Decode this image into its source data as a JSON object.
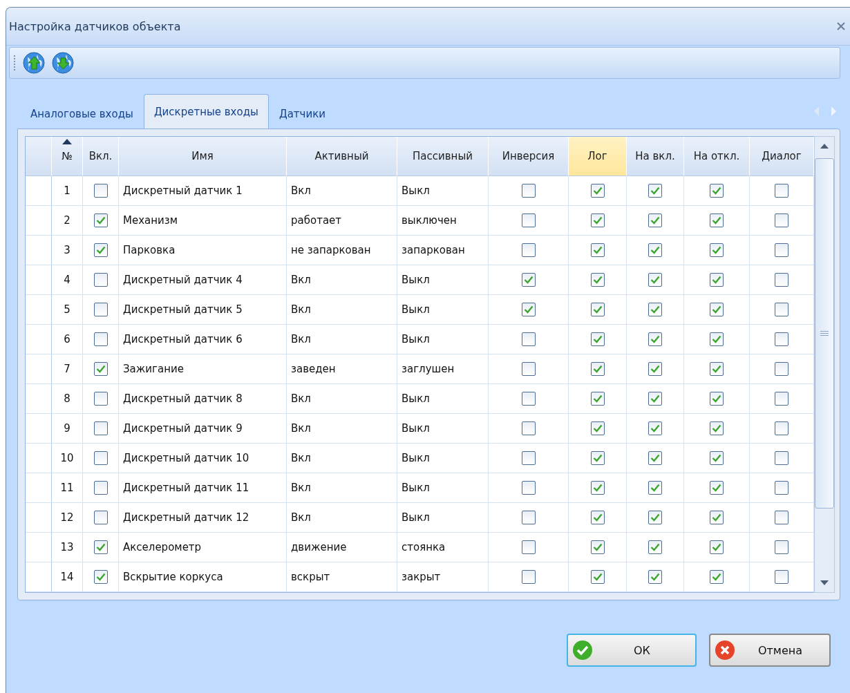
{
  "window": {
    "title": "Настройка датчиков объекта"
  },
  "tabs": [
    {
      "label": "Аналоговые входы",
      "selected": false
    },
    {
      "label": "Дискретные входы",
      "selected": true
    },
    {
      "label": "Датчики",
      "selected": false
    }
  ],
  "table": {
    "columns": [
      {
        "label": "№",
        "kind": "number",
        "sorted": true,
        "highlighted": false
      },
      {
        "label": "Вкл.",
        "kind": "check",
        "sorted": false,
        "highlighted": false
      },
      {
        "label": "Имя",
        "kind": "text",
        "sorted": false,
        "highlighted": false
      },
      {
        "label": "Активный",
        "kind": "text",
        "sorted": false,
        "highlighted": false
      },
      {
        "label": "Пассивный",
        "kind": "text",
        "sorted": false,
        "highlighted": false
      },
      {
        "label": "Инверсия",
        "kind": "check",
        "sorted": false,
        "highlighted": false
      },
      {
        "label": "Лог",
        "kind": "check",
        "sorted": false,
        "highlighted": true
      },
      {
        "label": "На вкл.",
        "kind": "check",
        "sorted": false,
        "highlighted": false
      },
      {
        "label": "На откл.",
        "kind": "check",
        "sorted": false,
        "highlighted": false
      },
      {
        "label": "Диалог",
        "kind": "check",
        "sorted": false,
        "highlighted": false
      }
    ],
    "rows": [
      {
        "cells": [
          "1",
          false,
          "Дискретный датчик 1",
          "Вкл",
          "Выкл",
          false,
          true,
          true,
          true,
          false
        ]
      },
      {
        "cells": [
          "2",
          true,
          "Механизм",
          "работает",
          "выключен",
          false,
          true,
          true,
          true,
          false
        ]
      },
      {
        "cells": [
          "3",
          true,
          "Парковка",
          "не запаркован",
          "запаркован",
          false,
          true,
          true,
          true,
          false
        ]
      },
      {
        "cells": [
          "4",
          false,
          "Дискретный датчик 4",
          "Вкл",
          "Выкл",
          true,
          true,
          true,
          true,
          false
        ]
      },
      {
        "cells": [
          "5",
          false,
          "Дискретный датчик 5",
          "Вкл",
          "Выкл",
          true,
          true,
          true,
          true,
          false
        ]
      },
      {
        "cells": [
          "6",
          false,
          "Дискретный датчик 6",
          "Вкл",
          "Выкл",
          false,
          true,
          true,
          true,
          false
        ]
      },
      {
        "cells": [
          "7",
          true,
          "Зажигание",
          "заведен",
          "заглушен",
          false,
          true,
          true,
          true,
          false
        ]
      },
      {
        "cells": [
          "8",
          false,
          "Дискретный датчик 8",
          "Вкл",
          "Выкл",
          false,
          true,
          true,
          true,
          false
        ]
      },
      {
        "cells": [
          "9",
          false,
          "Дискретный датчик 9",
          "Вкл",
          "Выкл",
          false,
          true,
          true,
          true,
          false
        ]
      },
      {
        "cells": [
          "10",
          false,
          "Дискретный датчик 10",
          "Вкл",
          "Выкл",
          false,
          true,
          true,
          true,
          false
        ]
      },
      {
        "cells": [
          "11",
          false,
          "Дискретный датчик 11",
          "Вкл",
          "Выкл",
          false,
          true,
          true,
          true,
          false
        ]
      },
      {
        "cells": [
          "12",
          false,
          "Дискретный датчик 12",
          "Вкл",
          "Выкл",
          false,
          true,
          true,
          true,
          false
        ]
      },
      {
        "cells": [
          "13",
          true,
          "Акселерометр",
          "движение",
          "стоянка",
          false,
          true,
          true,
          true,
          false
        ]
      },
      {
        "cells": [
          "14",
          true,
          "Вскрытие коркуса",
          "вскрыт",
          "закрыт",
          false,
          true,
          true,
          true,
          false
        ]
      }
    ]
  },
  "buttons": [
    {
      "label": "ОК",
      "kind": "ok"
    },
    {
      "label": "Отмена",
      "kind": "cancel"
    }
  ]
}
